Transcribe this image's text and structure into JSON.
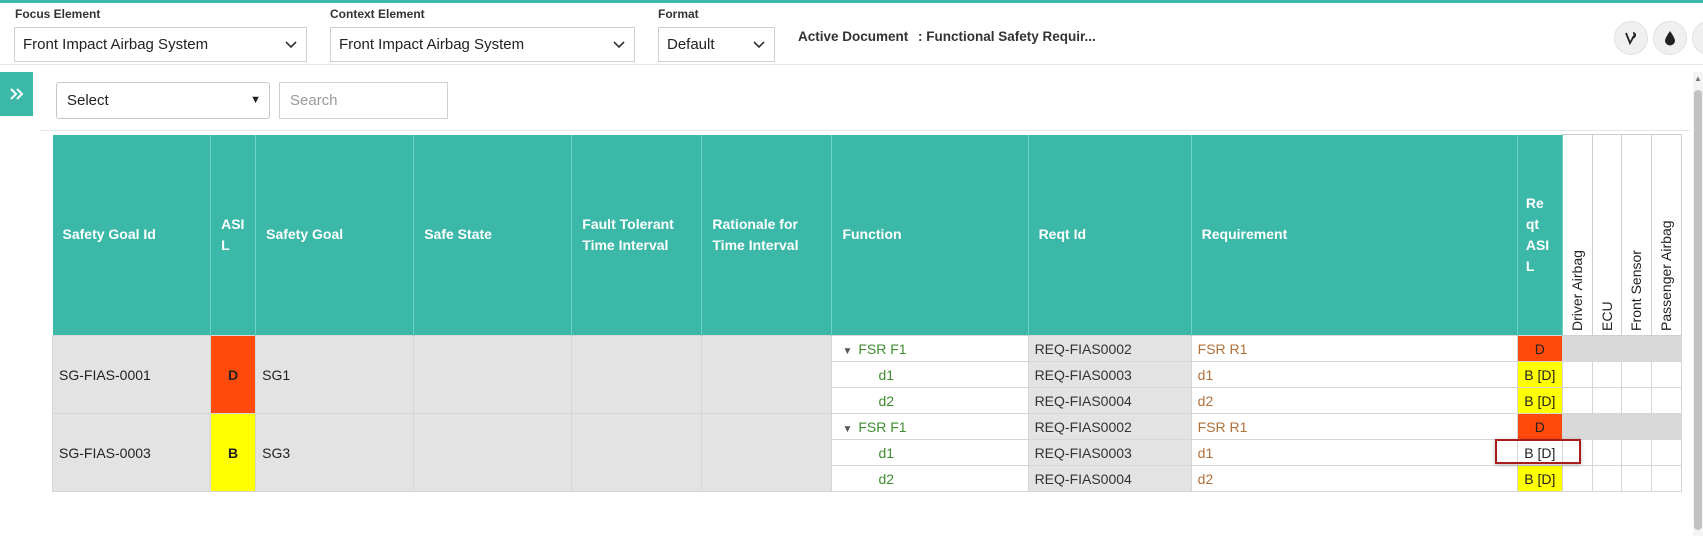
{
  "header": {
    "focus": {
      "label": "Focus Element",
      "value": "Front Impact Airbag System"
    },
    "context": {
      "label": "Context Element",
      "value": "Front Impact Airbag System"
    },
    "format": {
      "label": "Format",
      "value": "Default"
    },
    "active_doc_label": "Active Document",
    "active_doc_value": ": Functional Safety Requir...",
    "icons": [
      "vine-icon",
      "drop-icon"
    ]
  },
  "filters": {
    "select_label": "Select",
    "search_placeholder": "Search"
  },
  "table": {
    "columns": {
      "sg_id": "Safety Goal Id",
      "asil": "ASI L",
      "safety_goal": "Safety Goal",
      "safe_state": "Safe State",
      "ftti": "Fault Tolerant Time Interval",
      "rationale": "Rationale for Time Interval",
      "function": "Function",
      "reqt_id": "Reqt Id",
      "requirement": "Requirement",
      "reqt_asil": "Re qt ASI L",
      "driver_airbag": "Driver Airbag",
      "ecu": "ECU",
      "front_sensor": "Front Sensor",
      "passenger_airbag": "Passenger Airbag"
    },
    "groups": [
      {
        "sg_id": "SG-FIAS-0001",
        "asil": "D",
        "safety_goal": "SG1",
        "rows": [
          {
            "function": "FSR F1",
            "reqt_id": "REQ-FIAS0002",
            "requirement": "FSR R1",
            "reqt_asil": "D"
          },
          {
            "function": "d1",
            "reqt_id": "REQ-FIAS0003",
            "requirement": "d1",
            "reqt_asil": "B [D]"
          },
          {
            "function": "d2",
            "reqt_id": "REQ-FIAS0004",
            "requirement": "d2",
            "reqt_asil": "B [D]"
          }
        ]
      },
      {
        "sg_id": "SG-FIAS-0003",
        "asil": "B",
        "safety_goal": "SG3",
        "rows": [
          {
            "function": "FSR F1",
            "reqt_id": "REQ-FIAS0002",
            "requirement": "FSR R1",
            "reqt_asil": "D"
          },
          {
            "function": "d1",
            "reqt_id": "REQ-FIAS0003",
            "requirement": "d1",
            "reqt_asil": "B [D]"
          },
          {
            "function": "d2",
            "reqt_id": "REQ-FIAS0004",
            "requirement": "d2",
            "reqt_asil": "B [D]"
          }
        ]
      }
    ]
  },
  "colors": {
    "accent": "#3bb8a8",
    "asil_d": "#ff4a0b",
    "asil_b": "#ffff00",
    "function_text": "#3e8c2f",
    "requirement_text": "#b0703a",
    "highlight": "#a81c1c"
  }
}
